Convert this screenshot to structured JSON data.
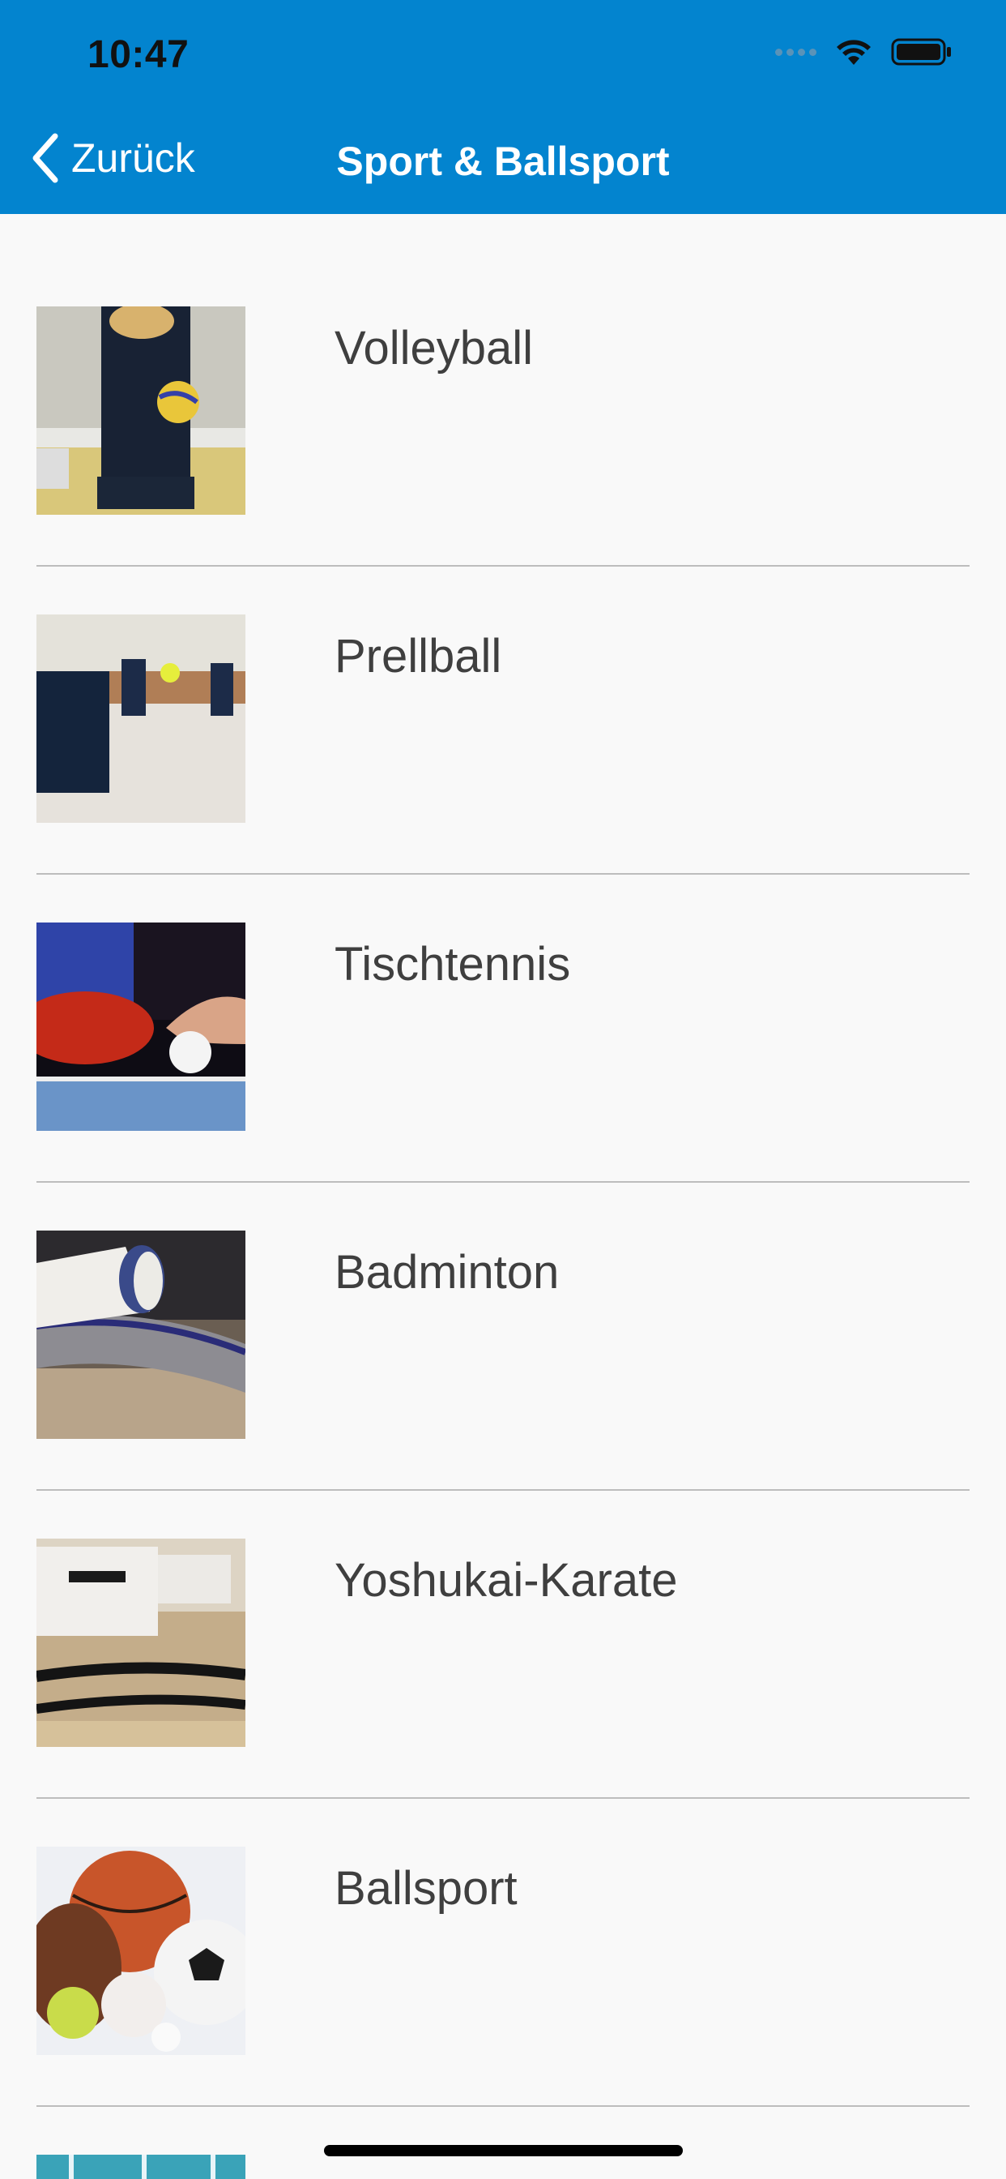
{
  "status_bar": {
    "time": "10:47",
    "icons": [
      "signal-icon",
      "wifi-icon",
      "battery-icon"
    ]
  },
  "nav": {
    "back_label": "Zurück",
    "title": "Sport & Ballsport"
  },
  "colors": {
    "header_bg": "#0384cf",
    "list_bg": "#f9f9f9",
    "label_text": "#3f3f3f",
    "divider": "#bdbdbd"
  },
  "list": {
    "items": [
      {
        "label": "Volleyball",
        "image": "volleyball-photo"
      },
      {
        "label": "Prellball",
        "image": "prellball-photo"
      },
      {
        "label": "Tischtennis",
        "image": "tischtennis-photo"
      },
      {
        "label": "Badminton",
        "image": "badminton-photo"
      },
      {
        "label": "Yoshukai-Karate",
        "image": "karate-photo"
      },
      {
        "label": "Ballsport",
        "image": "ballsport-photo"
      }
    ]
  }
}
